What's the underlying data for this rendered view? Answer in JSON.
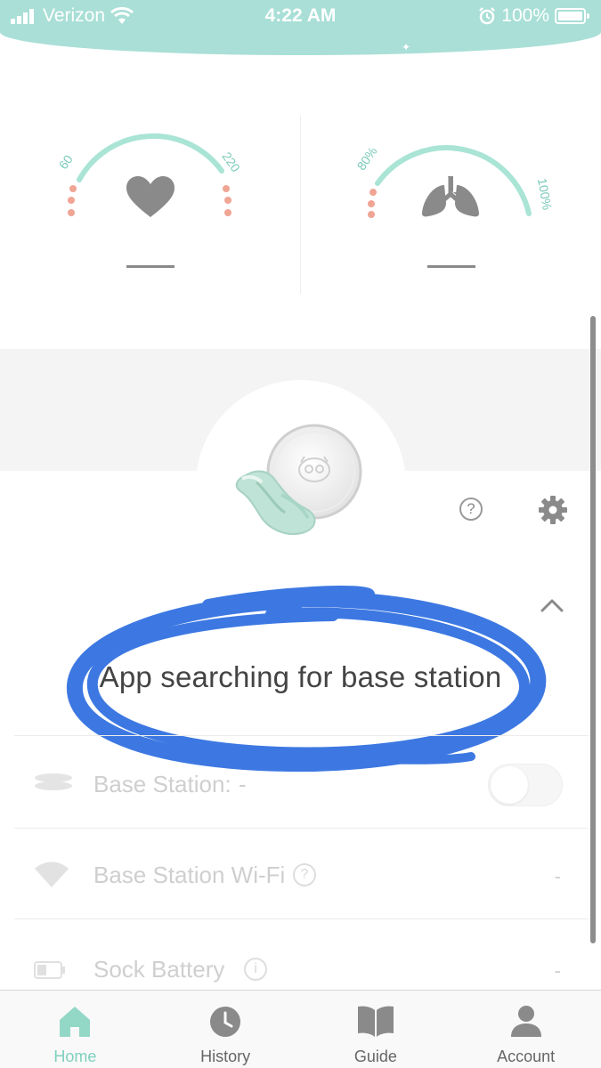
{
  "status_bar": {
    "carrier": "Verizon",
    "time": "4:22 AM",
    "battery": "100%"
  },
  "gauges": {
    "heart_rate": {
      "min_label": "60",
      "max_label": "220",
      "value": "—",
      "icon": "heart-icon"
    },
    "oxygen": {
      "min_label": "80%",
      "max_label": "100%",
      "value": "—",
      "icon": "lungs-icon"
    }
  },
  "message": "App searching for base station",
  "list": {
    "base_station": {
      "label": "Base Station:",
      "value": "-"
    },
    "wifi": {
      "label": "Base Station Wi-Fi",
      "value": "-",
      "help": "?"
    },
    "battery": {
      "label": "Sock Battery",
      "value": "-",
      "help": "i"
    }
  },
  "help_label": "?",
  "tabs": [
    {
      "label": "Home",
      "icon": "home-icon",
      "active": true
    },
    {
      "label": "History",
      "icon": "clock-icon",
      "active": false
    },
    {
      "label": "Guide",
      "icon": "book-icon",
      "active": false
    },
    {
      "label": "Account",
      "icon": "person-icon",
      "active": false
    }
  ],
  "colors": {
    "accent": "#a9dfd6",
    "active_tab": "#7fd0bd",
    "annotation": "#2d6de0",
    "gauge_low": "#f0a595"
  }
}
